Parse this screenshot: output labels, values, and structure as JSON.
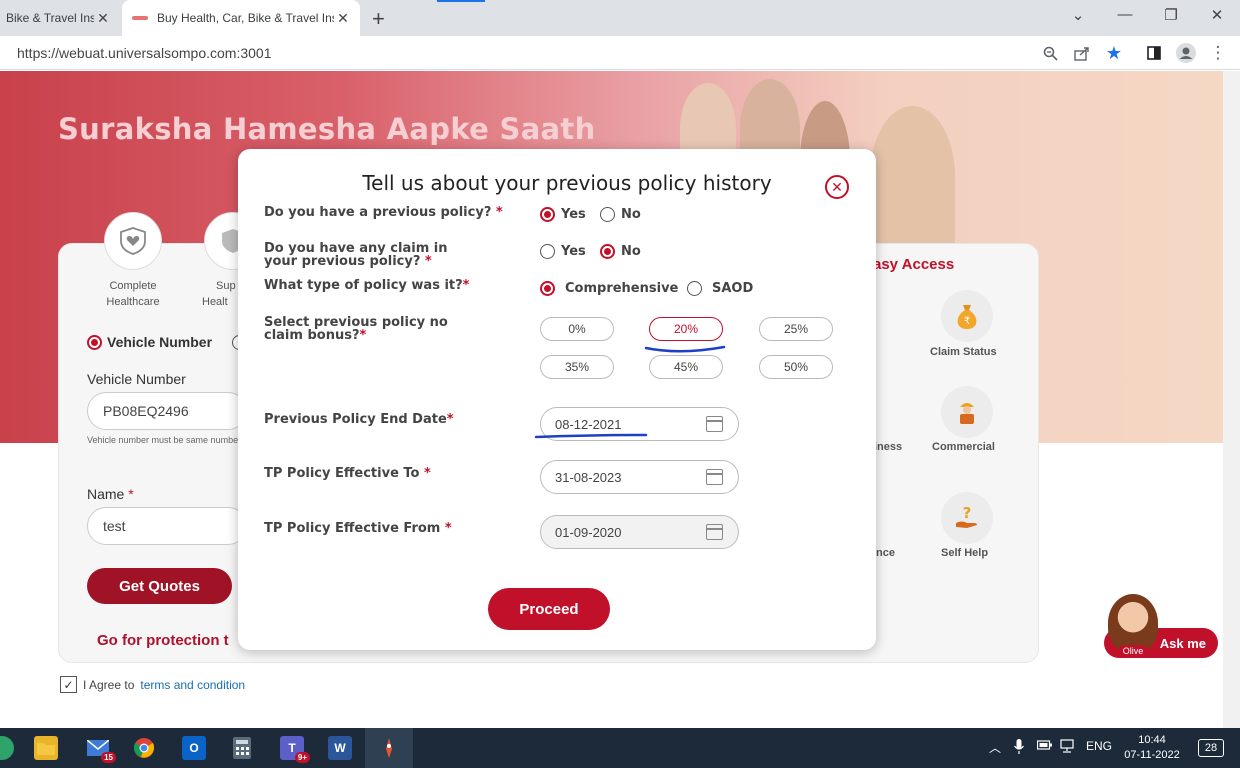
{
  "browser": {
    "tabs": [
      {
        "title": "Bike & Travel Ins",
        "active": false
      },
      {
        "title": "Buy Health, Car, Bike & Travel Ins",
        "active": true
      }
    ],
    "new_tab": "+",
    "url": "https://webuat.universalsompo.com:3001"
  },
  "hero": {
    "title": "Suraksha Hamesha Aapke Saath"
  },
  "features": [
    {
      "label_line1": "Complete",
      "label_line2": "Healthcare"
    },
    {
      "label_line1": "Sup",
      "label_line2": "Healt"
    }
  ],
  "form": {
    "vehicle_radio": "Vehicle Number",
    "vehicle_label": "Vehicle Number",
    "vehicle_value": "PB08EQ2496",
    "vehicle_hint": "Vehicle number must be same number.",
    "name_label": "Name",
    "name_required": "*",
    "name_value": "test",
    "get_quotes": "Get Quotes",
    "protection_text": "Go for protection t"
  },
  "easy_access": {
    "title": "asy Access",
    "items": [
      {
        "label": "Claim Status",
        "icon": "money-bag-icon"
      },
      {
        "label": "iness",
        "icon": ""
      },
      {
        "label": "Commercial",
        "icon": "worker-icon"
      },
      {
        "label": "nce",
        "icon": ""
      },
      {
        "label": "Self Help",
        "icon": "hand-question-icon"
      }
    ]
  },
  "agree": {
    "text": "I Agree to",
    "link": "terms and condition",
    "checked": true
  },
  "chatbot": {
    "name": "Olive",
    "button": "Ask me"
  },
  "modal": {
    "title": "Tell us about your previous policy history",
    "q1": {
      "label": "Do you have a previous policy?",
      "req": "*",
      "options": [
        "Yes",
        "No"
      ],
      "selected": "Yes"
    },
    "q2": {
      "label": "Do you have any claim in your previous policy?",
      "req": "*",
      "options": [
        "Yes",
        "No"
      ],
      "selected": "No"
    },
    "q3": {
      "label": "What type of policy was it?",
      "req": "*",
      "options": [
        "Comprehensive",
        "SAOD"
      ],
      "selected": "Comprehensive"
    },
    "q4": {
      "label": "Select previous policy no claim bonus?",
      "req": "*",
      "options": [
        "0%",
        "20%",
        "25%",
        "35%",
        "45%",
        "50%"
      ],
      "selected": "20%"
    },
    "end_date": {
      "label": "Previous Policy End Date",
      "req": "*",
      "value": "08-12-2021"
    },
    "tp_to": {
      "label": "TP Policy Effective To",
      "req": "*",
      "value": "31-08-2023"
    },
    "tp_from": {
      "label": "TP Policy Effective From",
      "req": "*",
      "value": "01-09-2020"
    },
    "proceed": "Proceed"
  },
  "taskbar": {
    "mail_badge": "15",
    "teams_badge": "9+",
    "lang": "ENG",
    "time": "10:44",
    "date": "07-11-2022",
    "notifications": "28"
  },
  "colors": {
    "brand_red": "#c0102a",
    "annotation_blue": "#1e40c8"
  }
}
